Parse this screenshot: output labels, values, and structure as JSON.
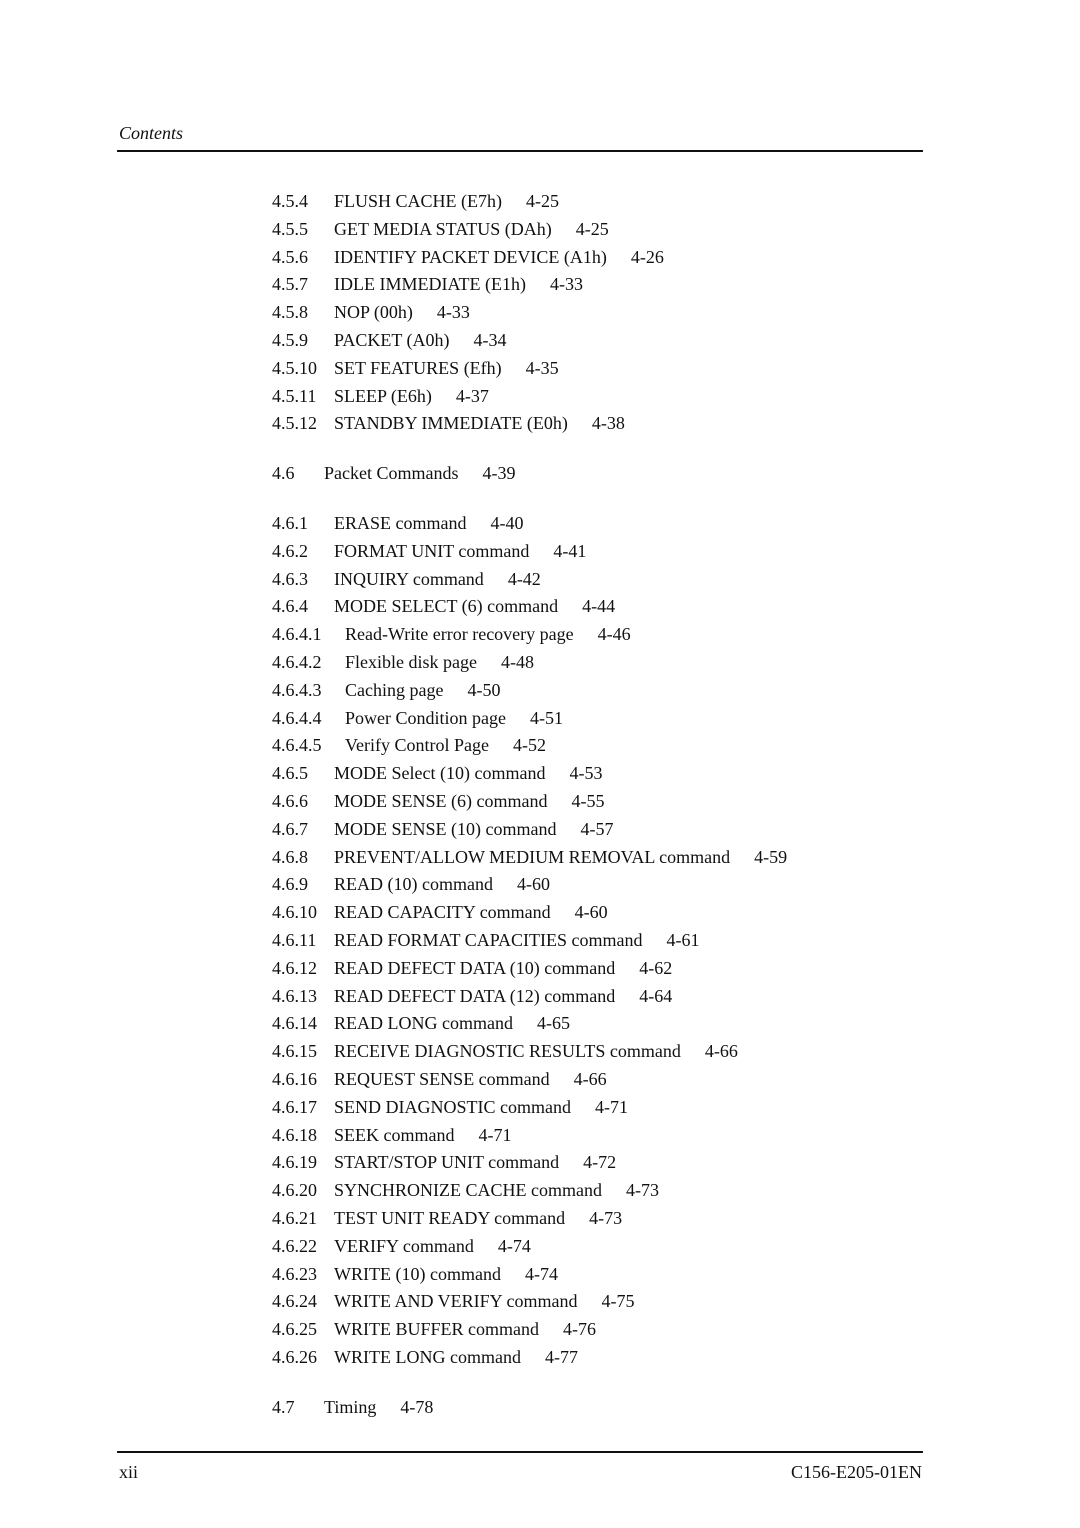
{
  "header": {
    "title": "Contents"
  },
  "toc": [
    {
      "num": "4.5.4",
      "title": "FLUSH CACHE (E7h)",
      "page": "4-25",
      "level": 3
    },
    {
      "num": "4.5.5",
      "title": "GET MEDIA STATUS (DAh)",
      "page": "4-25",
      "level": 3
    },
    {
      "num": "4.5.6",
      "title": "IDENTIFY PACKET DEVICE (A1h)",
      "page": "4-26",
      "level": 3
    },
    {
      "num": "4.5.7",
      "title": "IDLE IMMEDIATE (E1h)",
      "page": "4-33",
      "level": 3
    },
    {
      "num": "4.5.8",
      "title": "NOP (00h)",
      "page": "4-33",
      "level": 3
    },
    {
      "num": "4.5.9",
      "title": "PACKET (A0h)",
      "page": "4-34",
      "level": 3
    },
    {
      "num": "4.5.10",
      "title": "SET FEATURES (Efh)",
      "page": "4-35",
      "level": 3
    },
    {
      "num": "4.5.11",
      "title": "SLEEP (E6h)",
      "page": "4-37",
      "level": 3
    },
    {
      "num": "4.5.12",
      "title": "STANDBY IMMEDIATE (E0h)",
      "page": "4-38",
      "level": 3
    },
    {
      "num": "4.6",
      "title": "Packet Commands",
      "page": "4-39",
      "level": 2
    },
    {
      "num": "4.6.1",
      "title": "ERASE command",
      "page": "4-40",
      "level": 3
    },
    {
      "num": "4.6.2",
      "title": "FORMAT UNIT command",
      "page": "4-41",
      "level": 3
    },
    {
      "num": "4.6.3",
      "title": "INQUIRY command",
      "page": "4-42",
      "level": 3
    },
    {
      "num": "4.6.4",
      "title": "MODE SELECT (6) command",
      "page": "4-44",
      "level": 3
    },
    {
      "num": "4.6.4.1",
      "title": "Read-Write error recovery page",
      "page": "4-46",
      "level": 4
    },
    {
      "num": "4.6.4.2",
      "title": "Flexible disk page",
      "page": "4-48",
      "level": 4
    },
    {
      "num": "4.6.4.3",
      "title": "Caching page",
      "page": "4-50",
      "level": 4
    },
    {
      "num": "4.6.4.4",
      "title": "Power Condition page",
      "page": "4-51",
      "level": 4
    },
    {
      "num": "4.6.4.5",
      "title": "Verify Control Page",
      "page": "4-52",
      "level": 4
    },
    {
      "num": "4.6.5",
      "title": "MODE Select (10) command",
      "page": "4-53",
      "level": 3
    },
    {
      "num": "4.6.6",
      "title": "MODE SENSE (6) command",
      "page": "4-55",
      "level": 3
    },
    {
      "num": "4.6.7",
      "title": "MODE SENSE (10) command",
      "page": "4-57",
      "level": 3
    },
    {
      "num": "4.6.8",
      "title": "PREVENT/ALLOW MEDIUM REMOVAL command",
      "page": "4-59",
      "level": 3
    },
    {
      "num": "4.6.9",
      "title": "READ (10) command",
      "page": "4-60",
      "level": 3
    },
    {
      "num": "4.6.10",
      "title": "READ CAPACITY command",
      "page": "4-60",
      "level": 3
    },
    {
      "num": "4.6.11",
      "title": "READ FORMAT CAPACITIES command",
      "page": "4-61",
      "level": 3
    },
    {
      "num": "4.6.12",
      "title": "READ DEFECT DATA (10) command",
      "page": "4-62",
      "level": 3
    },
    {
      "num": "4.6.13",
      "title": "READ DEFECT DATA (12) command",
      "page": "4-64",
      "level": 3
    },
    {
      "num": "4.6.14",
      "title": "READ LONG command",
      "page": "4-65",
      "level": 3
    },
    {
      "num": "4.6.15",
      "title": "RECEIVE DIAGNOSTIC RESULTS command",
      "page": "4-66",
      "level": 3
    },
    {
      "num": "4.6.16",
      "title": "REQUEST SENSE command",
      "page": "4-66",
      "level": 3
    },
    {
      "num": "4.6.17",
      "title": "SEND DIAGNOSTIC command",
      "page": "4-71",
      "level": 3
    },
    {
      "num": "4.6.18",
      "title": "SEEK command",
      "page": "4-71",
      "level": 3
    },
    {
      "num": "4.6.19",
      "title": "START/STOP UNIT command",
      "page": "4-72",
      "level": 3
    },
    {
      "num": "4.6.20",
      "title": "SYNCHRONIZE CACHE command",
      "page": "4-73",
      "level": 3
    },
    {
      "num": "4.6.21",
      "title": "TEST UNIT READY command",
      "page": "4-73",
      "level": 3
    },
    {
      "num": "4.6.22",
      "title": "VERIFY command",
      "page": "4-74",
      "level": 3
    },
    {
      "num": "4.6.23",
      "title": "WRITE (10) command",
      "page": "4-74",
      "level": 3
    },
    {
      "num": "4.6.24",
      "title": "WRITE AND VERIFY command",
      "page": "4-75",
      "level": 3
    },
    {
      "num": "4.6.25",
      "title": "WRITE BUFFER command",
      "page": "4-76",
      "level": 3
    },
    {
      "num": "4.6.26",
      "title": "WRITE LONG command",
      "page": "4-77",
      "level": 3
    },
    {
      "num": "4.7",
      "title": "Timing",
      "page": "4-78",
      "level": 2
    }
  ],
  "footer": {
    "page_label": "xii",
    "doc_code": "C156-E205-01EN"
  }
}
